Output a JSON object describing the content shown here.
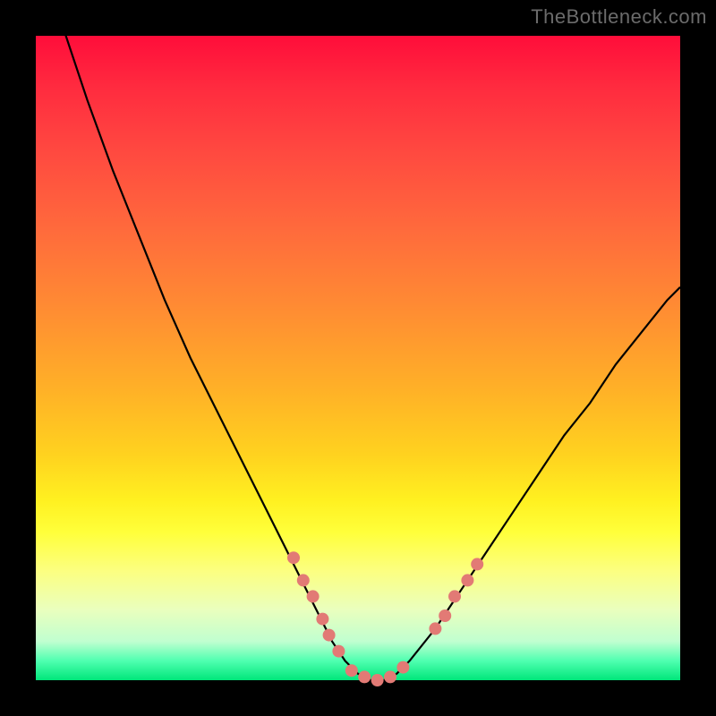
{
  "watermark": "TheBottleneck.com",
  "colors": {
    "frame": "#000000",
    "curve": "#000000",
    "markers": "#e27a75",
    "gradient_top": "#ff0d3a",
    "gradient_bottom": "#00e67a"
  },
  "chart_data": {
    "type": "line",
    "title": "",
    "xlabel": "",
    "ylabel": "",
    "xlim": [
      0,
      100
    ],
    "ylim": [
      0,
      100
    ],
    "series": [
      {
        "name": "bottleneck-curve",
        "x": [
          0,
          4,
          8,
          12,
          16,
          20,
          24,
          28,
          32,
          36,
          40,
          44,
          46,
          48,
          50,
          52,
          54,
          56,
          58,
          62,
          66,
          70,
          74,
          78,
          82,
          86,
          90,
          94,
          98,
          100
        ],
        "y": [
          113,
          102,
          90,
          79,
          69,
          59,
          50,
          42,
          34,
          26,
          18,
          10,
          6,
          3,
          1,
          0,
          0,
          1,
          3,
          8,
          14,
          20,
          26,
          32,
          38,
          43,
          49,
          54,
          59,
          61
        ]
      }
    ],
    "markers": [
      {
        "x": 40,
        "y": 19
      },
      {
        "x": 41.5,
        "y": 15.5
      },
      {
        "x": 43,
        "y": 13
      },
      {
        "x": 44.5,
        "y": 9.5
      },
      {
        "x": 45.5,
        "y": 7
      },
      {
        "x": 47,
        "y": 4.5
      },
      {
        "x": 49,
        "y": 1.5
      },
      {
        "x": 51,
        "y": 0.5
      },
      {
        "x": 53,
        "y": 0
      },
      {
        "x": 55,
        "y": 0.5
      },
      {
        "x": 57,
        "y": 2
      },
      {
        "x": 62,
        "y": 8
      },
      {
        "x": 63.5,
        "y": 10
      },
      {
        "x": 65,
        "y": 13
      },
      {
        "x": 67,
        "y": 15.5
      },
      {
        "x": 68.5,
        "y": 18
      }
    ]
  }
}
